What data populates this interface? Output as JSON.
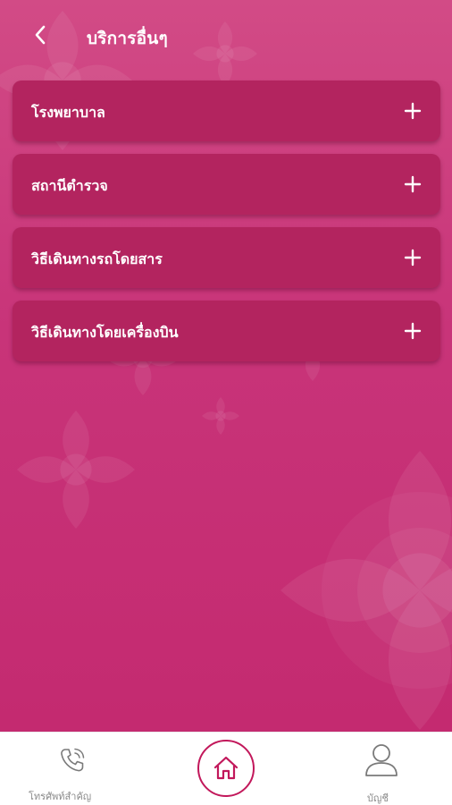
{
  "header": {
    "title": "บริการอื่นๆ",
    "back_icon": "chevron-left-icon"
  },
  "services": [
    {
      "label": "โรงพยาบาล",
      "icon": "plus-icon"
    },
    {
      "label": "สถานีตำรวจ",
      "icon": "plus-icon"
    },
    {
      "label": "วิธีเดินทางรถโดยสาร",
      "icon": "plus-icon"
    },
    {
      "label": "วิธีเดินทางโดยเครื่องบิน",
      "icon": "plus-icon"
    }
  ],
  "bottom_nav": {
    "phone": {
      "label": "โทรศัพท์สำคัญ",
      "icon": "phone-icon"
    },
    "home": {
      "icon": "home-icon"
    },
    "account": {
      "label": "บัญชี",
      "icon": "user-icon"
    }
  },
  "colors": {
    "background": "#c83479",
    "card": "#b3245f",
    "accent": "#c2185b",
    "nav_text": "#8a8a8a"
  }
}
